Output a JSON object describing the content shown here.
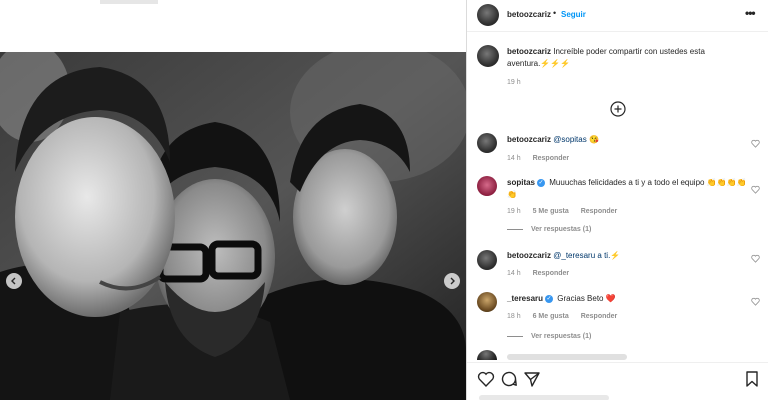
{
  "header": {
    "username": "betoozcariz",
    "separator": "•",
    "follow_label": "Seguir",
    "more_label": "•••"
  },
  "caption": {
    "username": "betoozcariz",
    "text": "Increíble poder compartir con ustedes esta aventura.⚡⚡⚡",
    "time": "19 h"
  },
  "comments": [
    {
      "username": "betoozcariz",
      "verified": false,
      "text": "@sopitas 😘",
      "time": "14 h",
      "likes": "",
      "reply_label": "Responder",
      "view_replies": ""
    },
    {
      "username": "sopitas",
      "verified": true,
      "text": "Muuuchas felicidades a ti y a todo el equipo 👏👏👏👏👏",
      "time": "19 h",
      "likes": "5 Me gusta",
      "reply_label": "Responder",
      "view_replies": "Ver respuestas (1)"
    },
    {
      "username": "betoozcariz",
      "verified": false,
      "text": "@_teresaru a ti.⚡",
      "time": "14 h",
      "likes": "",
      "reply_label": "Responder",
      "view_replies": ""
    },
    {
      "username": "_teresaru",
      "verified": true,
      "text": "Gracias Beto ❤️",
      "time": "18 h",
      "likes": "6 Me gusta",
      "reply_label": "Responder",
      "view_replies": "Ver respuestas (1)"
    }
  ],
  "icons": {
    "add": "plus-circle-icon",
    "like": "heart-icon",
    "comment": "comment-icon",
    "share": "paper-plane-icon",
    "save": "bookmark-icon",
    "prev": "chevron-left-icon",
    "next": "chevron-right-icon"
  },
  "colors": {
    "link": "#0095f6",
    "verified": "#3897f0",
    "muted": "#8e8e8e",
    "text": "#262626"
  }
}
